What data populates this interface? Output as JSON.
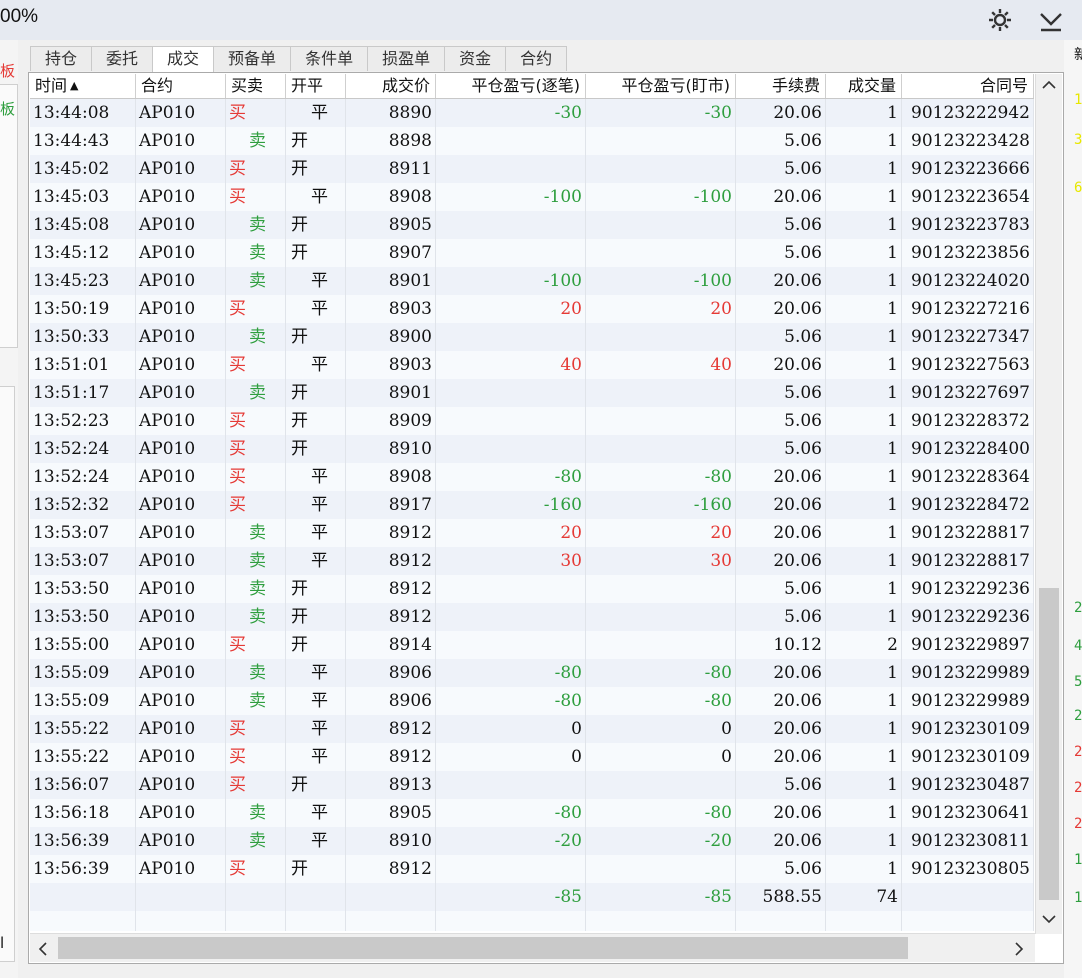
{
  "window": {
    "zoom": "00%"
  },
  "left_edge_chars": [
    {
      "text": "板",
      "color": "#e53935"
    },
    {
      "text": "板",
      "color": "#2e9e3e"
    },
    {
      "text": "l",
      "color": "#111111"
    }
  ],
  "tabs": [
    "持仓",
    "委托",
    "成交",
    "预备单",
    "条件单",
    "损盈单",
    "资金",
    "合约"
  ],
  "active_tab": "成交",
  "table": {
    "columns": [
      "时间",
      "合约",
      "买卖",
      "开平",
      "成交价",
      "平仓盈亏(逐笔)",
      "平仓盈亏(盯市)",
      "手续费",
      "成交量",
      "合同号"
    ],
    "sort_indicator": "▲",
    "rows": [
      [
        "13:44:08",
        "AP010",
        "买",
        "平",
        "8890",
        "-30",
        "-30",
        "20.06",
        "1",
        "90123222942"
      ],
      [
        "13:44:43",
        "AP010",
        "卖",
        "开",
        "8898",
        "",
        "",
        "5.06",
        "1",
        "90123223428"
      ],
      [
        "13:45:02",
        "AP010",
        "买",
        "开",
        "8911",
        "",
        "",
        "5.06",
        "1",
        "90123223666"
      ],
      [
        "13:45:03",
        "AP010",
        "买",
        "平",
        "8908",
        "-100",
        "-100",
        "20.06",
        "1",
        "90123223654"
      ],
      [
        "13:45:08",
        "AP010",
        "卖",
        "开",
        "8905",
        "",
        "",
        "5.06",
        "1",
        "90123223783"
      ],
      [
        "13:45:12",
        "AP010",
        "卖",
        "开",
        "8907",
        "",
        "",
        "5.06",
        "1",
        "90123223856"
      ],
      [
        "13:45:23",
        "AP010",
        "卖",
        "平",
        "8901",
        "-100",
        "-100",
        "20.06",
        "1",
        "90123224020"
      ],
      [
        "13:50:19",
        "AP010",
        "买",
        "平",
        "8903",
        "20",
        "20",
        "20.06",
        "1",
        "90123227216"
      ],
      [
        "13:50:33",
        "AP010",
        "卖",
        "开",
        "8900",
        "",
        "",
        "5.06",
        "1",
        "90123227347"
      ],
      [
        "13:51:01",
        "AP010",
        "买",
        "平",
        "8903",
        "40",
        "40",
        "20.06",
        "1",
        "90123227563"
      ],
      [
        "13:51:17",
        "AP010",
        "卖",
        "开",
        "8901",
        "",
        "",
        "5.06",
        "1",
        "90123227697"
      ],
      [
        "13:52:23",
        "AP010",
        "买",
        "开",
        "8909",
        "",
        "",
        "5.06",
        "1",
        "90123228372"
      ],
      [
        "13:52:24",
        "AP010",
        "买",
        "开",
        "8910",
        "",
        "",
        "5.06",
        "1",
        "90123228400"
      ],
      [
        "13:52:24",
        "AP010",
        "买",
        "平",
        "8908",
        "-80",
        "-80",
        "20.06",
        "1",
        "90123228364"
      ],
      [
        "13:52:32",
        "AP010",
        "买",
        "平",
        "8917",
        "-160",
        "-160",
        "20.06",
        "1",
        "90123228472"
      ],
      [
        "13:53:07",
        "AP010",
        "卖",
        "平",
        "8912",
        "20",
        "20",
        "20.06",
        "1",
        "90123228817"
      ],
      [
        "13:53:07",
        "AP010",
        "卖",
        "平",
        "8912",
        "30",
        "30",
        "20.06",
        "1",
        "90123228817"
      ],
      [
        "13:53:50",
        "AP010",
        "卖",
        "开",
        "8912",
        "",
        "",
        "5.06",
        "1",
        "90123229236"
      ],
      [
        "13:53:50",
        "AP010",
        "卖",
        "开",
        "8912",
        "",
        "",
        "5.06",
        "1",
        "90123229236"
      ],
      [
        "13:55:00",
        "AP010",
        "买",
        "开",
        "8914",
        "",
        "",
        "10.12",
        "2",
        "90123229897"
      ],
      [
        "13:55:09",
        "AP010",
        "卖",
        "平",
        "8906",
        "-80",
        "-80",
        "20.06",
        "1",
        "90123229989"
      ],
      [
        "13:55:09",
        "AP010",
        "卖",
        "平",
        "8906",
        "-80",
        "-80",
        "20.06",
        "1",
        "90123229989"
      ],
      [
        "13:55:22",
        "AP010",
        "买",
        "平",
        "8912",
        "0",
        "0",
        "20.06",
        "1",
        "90123230109"
      ],
      [
        "13:55:22",
        "AP010",
        "买",
        "平",
        "8912",
        "0",
        "0",
        "20.06",
        "1",
        "90123230109"
      ],
      [
        "13:56:07",
        "AP010",
        "买",
        "开",
        "8913",
        "",
        "",
        "5.06",
        "1",
        "90123230487"
      ],
      [
        "13:56:18",
        "AP010",
        "卖",
        "平",
        "8905",
        "-80",
        "-80",
        "20.06",
        "1",
        "90123230641"
      ],
      [
        "13:56:39",
        "AP010",
        "卖",
        "平",
        "8910",
        "-20",
        "-20",
        "20.06",
        "1",
        "90123230811"
      ],
      [
        "13:56:39",
        "AP010",
        "买",
        "开",
        "8912",
        "",
        "",
        "5.06",
        "1",
        "90123230805"
      ]
    ],
    "totals": {
      "pnl_trade": "-85",
      "pnl_mtm": "-85",
      "fee": "588.55",
      "volume": "74"
    }
  },
  "right_edge_chars": [
    {
      "text": "新",
      "color": "#111111"
    },
    {
      "text": "1",
      "color": "#e8e800"
    },
    {
      "text": "3",
      "color": "#e8e800"
    },
    {
      "text": "6",
      "color": "#e8e800"
    },
    {
      "text": "2",
      "color": "#2e9e3e"
    },
    {
      "text": "4",
      "color": "#2e9e3e"
    },
    {
      "text": "5",
      "color": "#2e9e3e"
    },
    {
      "text": "2",
      "color": "#2e9e3e"
    },
    {
      "text": "2",
      "color": "#e53935"
    },
    {
      "text": "2",
      "color": "#e53935"
    },
    {
      "text": "2",
      "color": "#e53935"
    },
    {
      "text": "1",
      "color": "#2e9e3e"
    },
    {
      "text": "1",
      "color": "#2e9e3e"
    }
  ],
  "colors": {
    "buy": "#e53935",
    "sell": "#2e9e3e",
    "profit": "#e53935",
    "loss": "#2e9e3e",
    "row_alt": "#eef2f9"
  }
}
